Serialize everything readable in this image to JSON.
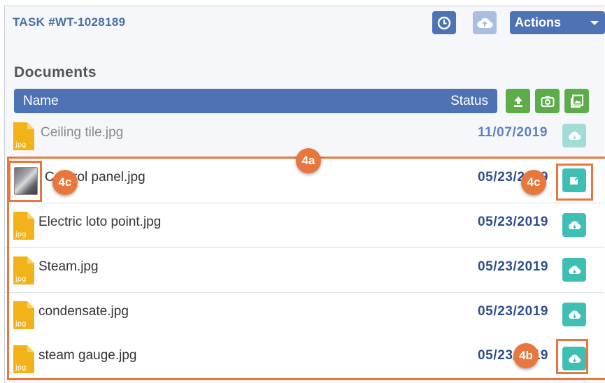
{
  "header": {
    "task_title": "TASK #WT-1028189",
    "actions_label": "Actions"
  },
  "documents": {
    "section_title": "Documents",
    "columns": {
      "name": "Name",
      "status": "Status"
    },
    "rows": [
      {
        "name": "Ceiling tile.jpg",
        "date": "11/07/2019",
        "icon": "jpg-file-icon",
        "ext": "jpg"
      },
      {
        "name": "Control panel.jpg",
        "date": "05/23/2019",
        "icon": "image-thumbnail",
        "ext": ""
      },
      {
        "name": "Electric loto point.jpg",
        "date": "05/23/2019",
        "icon": "jpg-file-icon",
        "ext": "jpg"
      },
      {
        "name": "Steam.jpg",
        "date": "05/23/2019",
        "icon": "jpg-file-icon",
        "ext": "jpg"
      },
      {
        "name": "condensate.jpg",
        "date": "05/23/2019",
        "icon": "jpg-file-icon",
        "ext": "jpg"
      },
      {
        "name": "steam gauge.jpg",
        "date": "05/23/2019",
        "icon": "jpg-file-icon",
        "ext": "jpg"
      }
    ]
  },
  "callouts": {
    "a": "4a",
    "b": "4b",
    "c_left": "4c",
    "c_right": "4c"
  },
  "colors": {
    "primary": "#4d73b5",
    "green": "#5cad4a",
    "teal": "#3fbfb4",
    "callout": "#e9763d",
    "date": "#2f4d8c"
  }
}
